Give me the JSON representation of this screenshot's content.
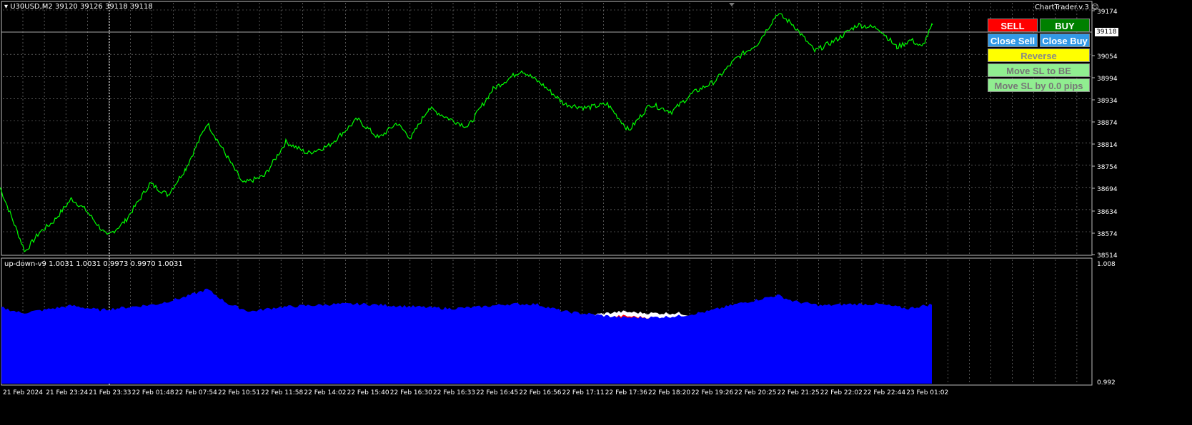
{
  "chart": {
    "symbol_header": "U30USD,M2  39120 39126 39118 39118",
    "indicator_header": "up-down-v9 1.0031 1.0031 0.9973 0.9970 1.0031",
    "ea_label": "ChartTrader.v.3",
    "current_price": "39118",
    "price_ticks": [
      "39174",
      "39054",
      "38994",
      "38934",
      "38874",
      "38814",
      "38754",
      "38694",
      "38634",
      "38574",
      "38514"
    ],
    "indicator_ticks": [
      "1.008",
      "0.992"
    ],
    "time_labels": [
      "21 Feb 2024",
      "21 Feb 23:24",
      "21 Feb 23:33",
      "22 Feb 01:48",
      "22 Feb 07:54",
      "22 Feb 10:51",
      "22 Feb 11:58",
      "22 Feb 14:02",
      "22 Feb 15:40",
      "22 Feb 16:30",
      "22 Feb 16:33",
      "22 Feb 16:45",
      "22 Feb 16:56",
      "22 Feb 17:11",
      "22 Feb 17:36",
      "22 Feb 18:20",
      "22 Feb 19:26",
      "22 Feb 20:25",
      "22 Feb 21:25",
      "22 Feb 22:02",
      "22 Feb 22:44",
      "23 Feb 01:02"
    ],
    "colors": {
      "price_line": "#00ff00",
      "grid": "#8a8a8a",
      "indicator_up": "#ff0000",
      "indicator_down": "#0000ff",
      "indicator_cap": "#ffffff"
    }
  },
  "chart_data": {
    "type": "line",
    "y_range": [
      38514,
      39174
    ],
    "price_series": [
      [
        0,
        38690
      ],
      [
        35,
        38520
      ],
      [
        55,
        38570
      ],
      [
        75,
        38600
      ],
      [
        100,
        38660
      ],
      [
        120,
        38630
      ],
      [
        150,
        38560
      ],
      [
        175,
        38600
      ],
      [
        210,
        38700
      ],
      [
        235,
        38670
      ],
      [
        260,
        38740
      ],
      [
        290,
        38860
      ],
      [
        315,
        38780
      ],
      [
        340,
        38700
      ],
      [
        370,
        38720
      ],
      [
        400,
        38810
      ],
      [
        430,
        38780
      ],
      [
        460,
        38800
      ],
      [
        500,
        38870
      ],
      [
        530,
        38820
      ],
      [
        555,
        38860
      ],
      [
        575,
        38820
      ],
      [
        600,
        38900
      ],
      [
        630,
        38870
      ],
      [
        655,
        38850
      ],
      [
        690,
        38950
      ],
      [
        730,
        39000
      ],
      [
        760,
        38960
      ],
      [
        790,
        38910
      ],
      [
        820,
        38900
      ],
      [
        850,
        38910
      ],
      [
        880,
        38840
      ],
      [
        910,
        38910
      ],
      [
        940,
        38890
      ],
      [
        970,
        38940
      ],
      [
        1000,
        38970
      ],
      [
        1030,
        39030
      ],
      [
        1060,
        39070
      ],
      [
        1088,
        39150
      ],
      [
        1110,
        39120
      ],
      [
        1140,
        39050
      ],
      [
        1170,
        39080
      ],
      [
        1200,
        39120
      ],
      [
        1230,
        39110
      ],
      [
        1255,
        39060
      ],
      [
        1275,
        39080
      ],
      [
        1290,
        39060
      ],
      [
        1305,
        39120
      ]
    ],
    "indicator": {
      "y_range": [
        0.992,
        1.008
      ],
      "up_upper": [
        [
          0,
          0.9985
        ],
        [
          30,
          0.9994
        ],
        [
          60,
          0.9992
        ],
        [
          100,
          0.999
        ],
        [
          140,
          0.9995
        ],
        [
          180,
          0.9992
        ],
        [
          220,
          0.999
        ],
        [
          260,
          0.9982
        ],
        [
          290,
          0.997
        ],
        [
          320,
          0.999
        ],
        [
          350,
          0.9998
        ],
        [
          390,
          0.999
        ],
        [
          430,
          0.9992
        ],
        [
          470,
          0.999
        ],
        [
          510,
          0.999
        ],
        [
          550,
          0.9992
        ],
        [
          590,
          0.9994
        ],
        [
          630,
          0.9996
        ],
        [
          670,
          0.999
        ],
        [
          710,
          0.9988
        ],
        [
          750,
          0.999
        ],
        [
          790,
          0.9998
        ],
        [
          830,
          1.0004
        ],
        [
          870,
          1.0008
        ],
        [
          910,
          1.0006
        ],
        [
          950,
          1.0006
        ],
        [
          990,
          1.0
        ],
        [
          1030,
          0.9992
        ],
        [
          1060,
          0.9984
        ],
        [
          1088,
          0.9978
        ],
        [
          1110,
          0.9986
        ],
        [
          1150,
          0.9992
        ],
        [
          1190,
          0.999
        ],
        [
          1230,
          0.999
        ],
        [
          1270,
          0.9996
        ],
        [
          1305,
          0.999
        ]
      ],
      "down_top": [
        [
          0,
          1.002
        ],
        [
          30,
          1.0012
        ],
        [
          60,
          1.0016
        ],
        [
          100,
          1.0022
        ],
        [
          140,
          1.0016
        ],
        [
          180,
          1.002
        ],
        [
          220,
          1.0024
        ],
        [
          260,
          1.0034
        ],
        [
          290,
          1.0044
        ],
        [
          320,
          1.0024
        ],
        [
          350,
          1.0014
        ],
        [
          390,
          1.002
        ],
        [
          430,
          1.0022
        ],
        [
          470,
          1.0024
        ],
        [
          510,
          1.0024
        ],
        [
          550,
          1.0022
        ],
        [
          590,
          1.002
        ],
        [
          630,
          1.0018
        ],
        [
          670,
          1.002
        ],
        [
          710,
          1.0024
        ],
        [
          750,
          1.0024
        ],
        [
          790,
          1.0014
        ],
        [
          830,
          1.001
        ],
        [
          870,
          1.0006
        ],
        [
          910,
          1.0006
        ],
        [
          950,
          1.0008
        ],
        [
          990,
          1.0014
        ],
        [
          1030,
          1.0024
        ],
        [
          1060,
          1.003
        ],
        [
          1088,
          1.0036
        ],
        [
          1110,
          1.0028
        ],
        [
          1150,
          1.0022
        ],
        [
          1190,
          1.0024
        ],
        [
          1230,
          1.0024
        ],
        [
          1270,
          1.0018
        ],
        [
          1305,
          1.0024
        ]
      ]
    }
  },
  "panel": {
    "sell_label": "SELL",
    "buy_label": "BUY",
    "close_sell_label": "Close Sell",
    "close_buy_label": "Close Buy",
    "reverse_label": "Reverse",
    "move_be_label": "Move SL to BE",
    "move_pips_label": "Move SL by 0.0 pips",
    "colors": {
      "sell": "#ff0000",
      "buy": "#008000",
      "close": "#3399e6",
      "reverse": "#ffff00",
      "move": "#90ee90"
    }
  }
}
